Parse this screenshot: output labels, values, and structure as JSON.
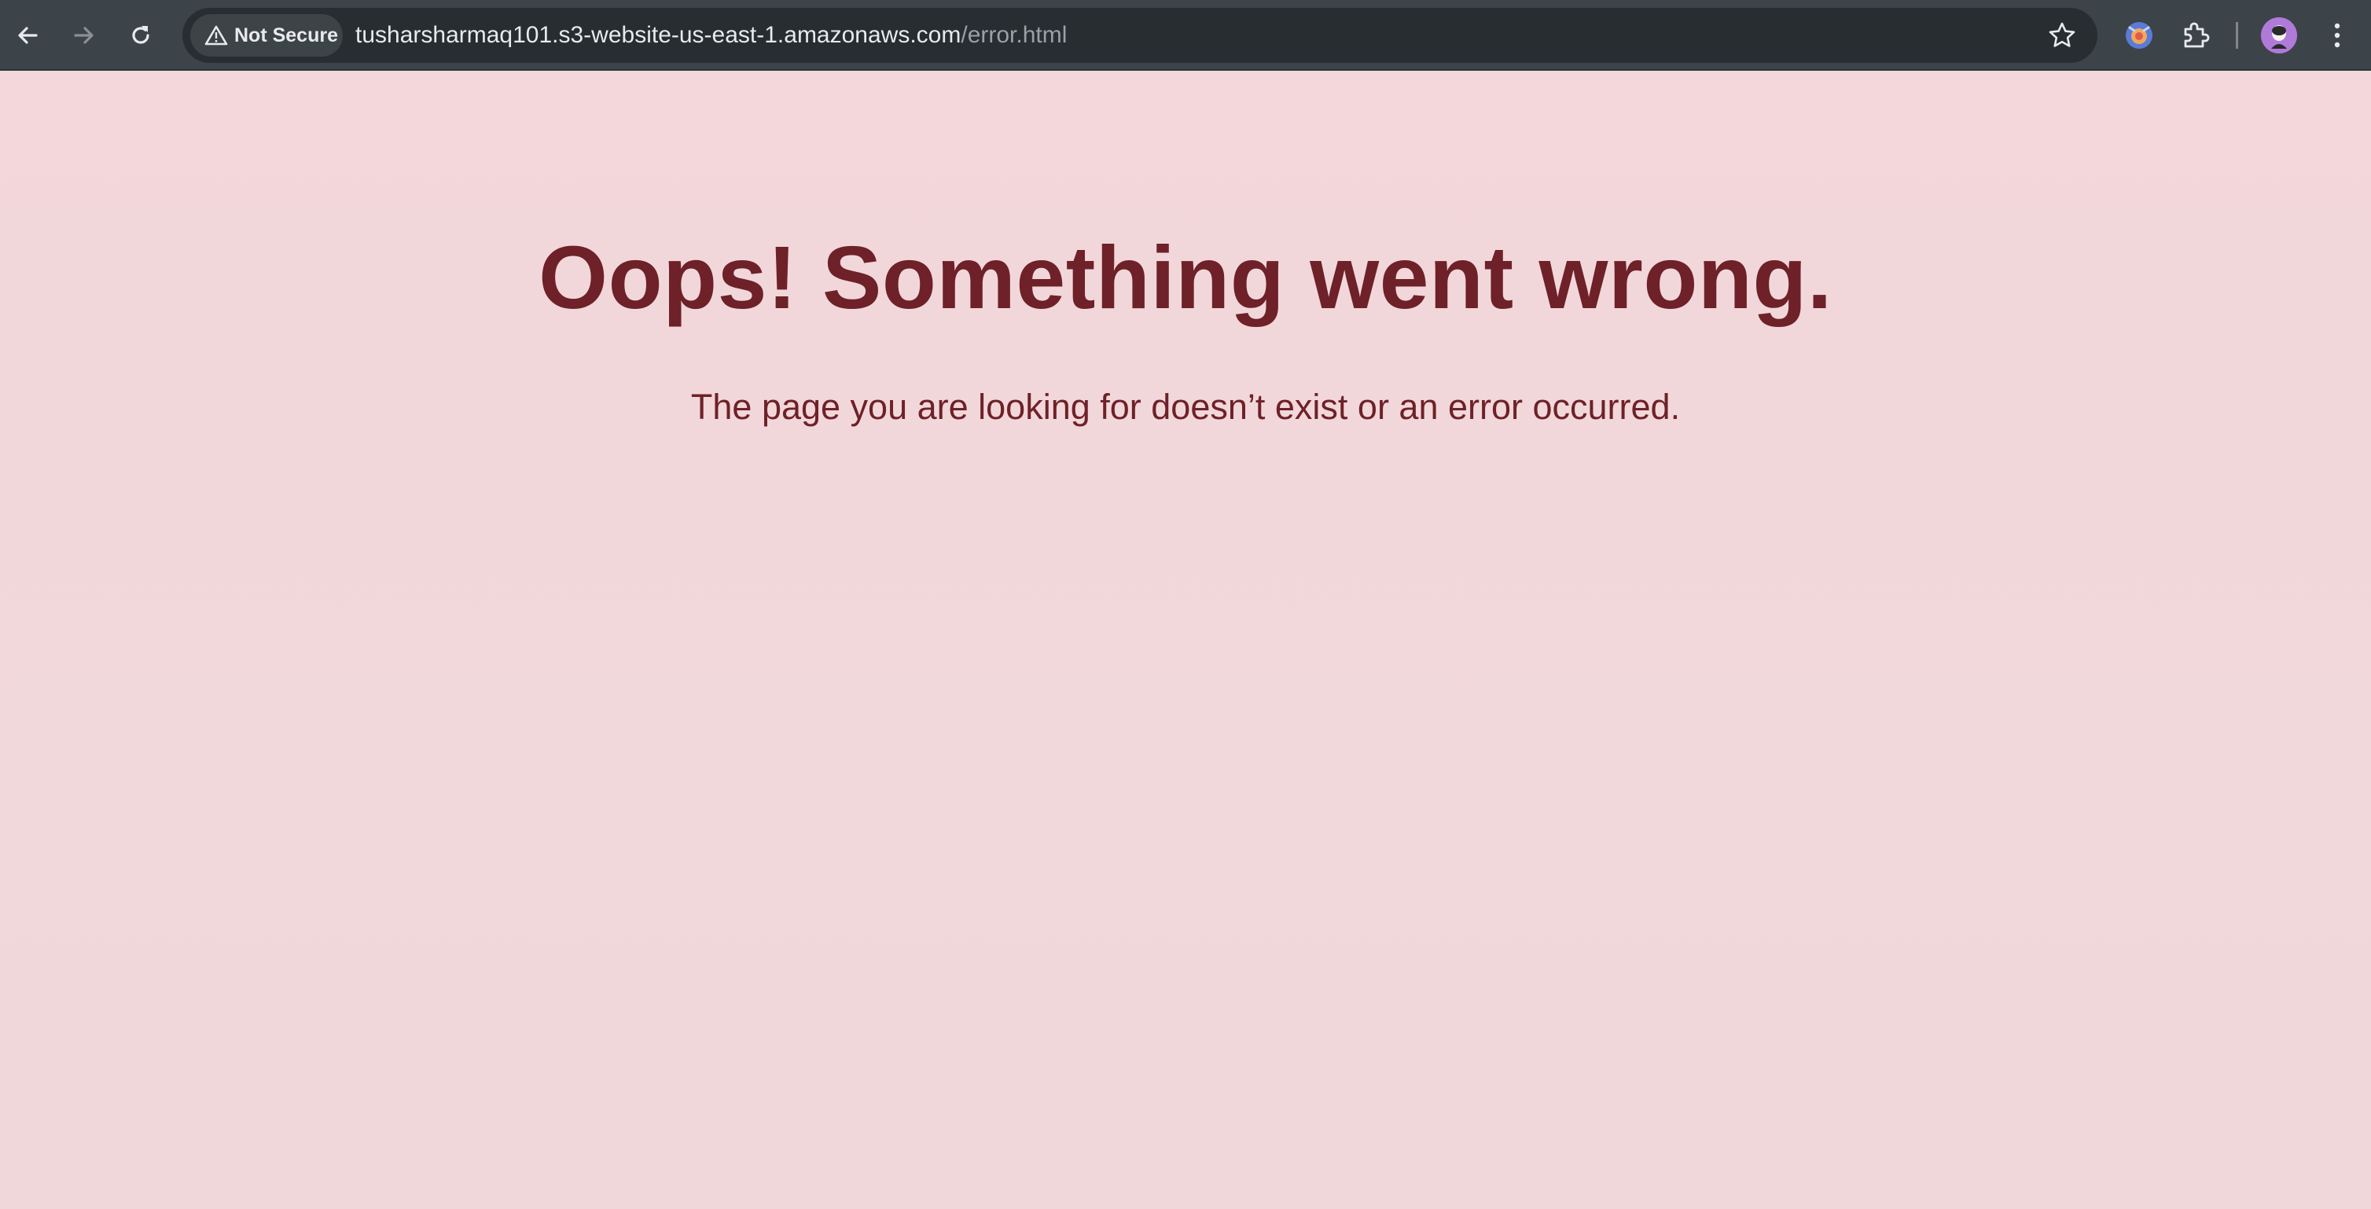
{
  "browser": {
    "security_label": "Not Secure",
    "url_host": "tusharsharmaq101.s3-website-us-east-1.amazonaws.com",
    "url_path": "/error.html",
    "icons": {
      "back": "arrow-left-icon",
      "forward": "arrow-right-icon",
      "reload": "reload-icon",
      "warning": "warning-triangle-icon",
      "bookmark": "star-icon",
      "extension_app": "extension-app-icon",
      "extensions": "puzzle-piece-icon",
      "profile": "avatar",
      "menu": "kebab-menu-icon"
    },
    "colors": {
      "toolbar": "#3c4449",
      "omnibox": "#282d31",
      "chip": "#3d4448",
      "avatar": "#a86fd6"
    }
  },
  "page": {
    "heading": "Oops! Something went wrong.",
    "message": "The page you are looking for doesn’t exist or an error occurred.",
    "colors": {
      "background": "#f2d7d9",
      "text": "#6e2128"
    }
  }
}
